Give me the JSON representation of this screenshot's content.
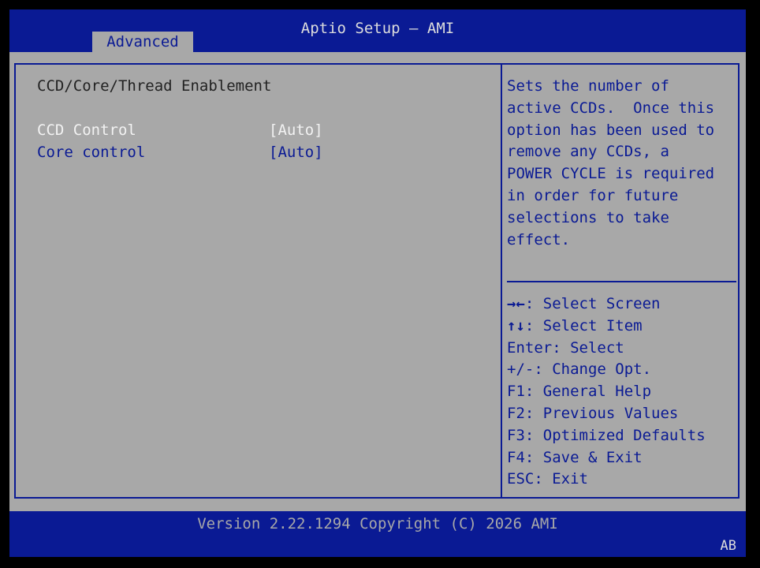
{
  "header": {
    "title": "Aptio Setup – AMI",
    "tabs": [
      {
        "label": "Advanced"
      }
    ]
  },
  "main": {
    "page_title": "CCD/Core/Thread Enablement",
    "settings": [
      {
        "label": "CCD Control",
        "value": "[Auto]",
        "selected": true
      },
      {
        "label": "Core control",
        "value": "[Auto]",
        "selected": false
      }
    ]
  },
  "help": {
    "lines": [
      "Sets the number of",
      "active CCDs.  Once this",
      "option has been used to",
      "remove any CCDs, a",
      "POWER CYCLE is required",
      "in order for future",
      "selections to take",
      "effect."
    ]
  },
  "keys": [
    {
      "key": "→←",
      "text": ": Select Screen"
    },
    {
      "key": "↑↓",
      "text": ": Select Item"
    },
    {
      "key": "Enter",
      "text": ": Select"
    },
    {
      "key": "+/-",
      "text": ": Change Opt."
    },
    {
      "key": "F1",
      "text": ": General Help"
    },
    {
      "key": "F2",
      "text": ": Previous Values"
    },
    {
      "key": "F3",
      "text": ": Optimized Defaults"
    },
    {
      "key": "F4",
      "text": ": Save & Exit"
    },
    {
      "key": "ESC",
      "text": ": Exit"
    }
  ],
  "footer": {
    "version": "Version 2.22.1294 Copyright (C) 2026 AMI",
    "code": "AB"
  },
  "colors": {
    "blue": "#0a1a94",
    "gray": "#a8a8a8",
    "highlight_text": "#f2f2f2",
    "title_text": "#dcdcdc"
  }
}
